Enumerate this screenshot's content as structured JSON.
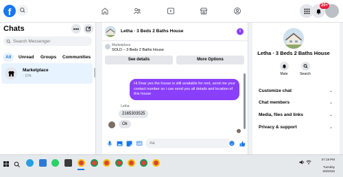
{
  "topbar": {
    "logo_letter": "f",
    "notification_count": "20+"
  },
  "chats": {
    "title": "Chats",
    "search_placeholder": "Search Messenger",
    "filters": [
      "All",
      "Unread",
      "Groups",
      "Communities"
    ],
    "conversation": {
      "name": "Marketplace",
      "time": "· 17h"
    }
  },
  "chat": {
    "title": "Letha · 3 Beds 2 Baths House",
    "listing_label": "Marketplace",
    "listing_title": "SOLD – 3 Beds 2 Baths House",
    "see_details": "See details",
    "more_options": "More Options",
    "outgoing_message": "Hi Dear yes the house is still available for rent, send me your contact number so i can send you all details and location of this house",
    "sender_name": "Letha",
    "incoming_messages": [
      "2165303525",
      "Ok"
    ],
    "composer_placeholder": "Aa"
  },
  "details": {
    "name": "Letha · 3 Beds 2 Baths House",
    "actions": [
      "Mute",
      "Search"
    ],
    "sections": [
      "Customize chat",
      "Chat members",
      "Media, files and links",
      "Privacy & support"
    ]
  },
  "taskbar": {
    "time": "07:19 PM",
    "day": "Tuesday",
    "date": "6/9/2026"
  },
  "colors": {
    "accent": "#1877f2",
    "theme": "#8a3ffc"
  }
}
